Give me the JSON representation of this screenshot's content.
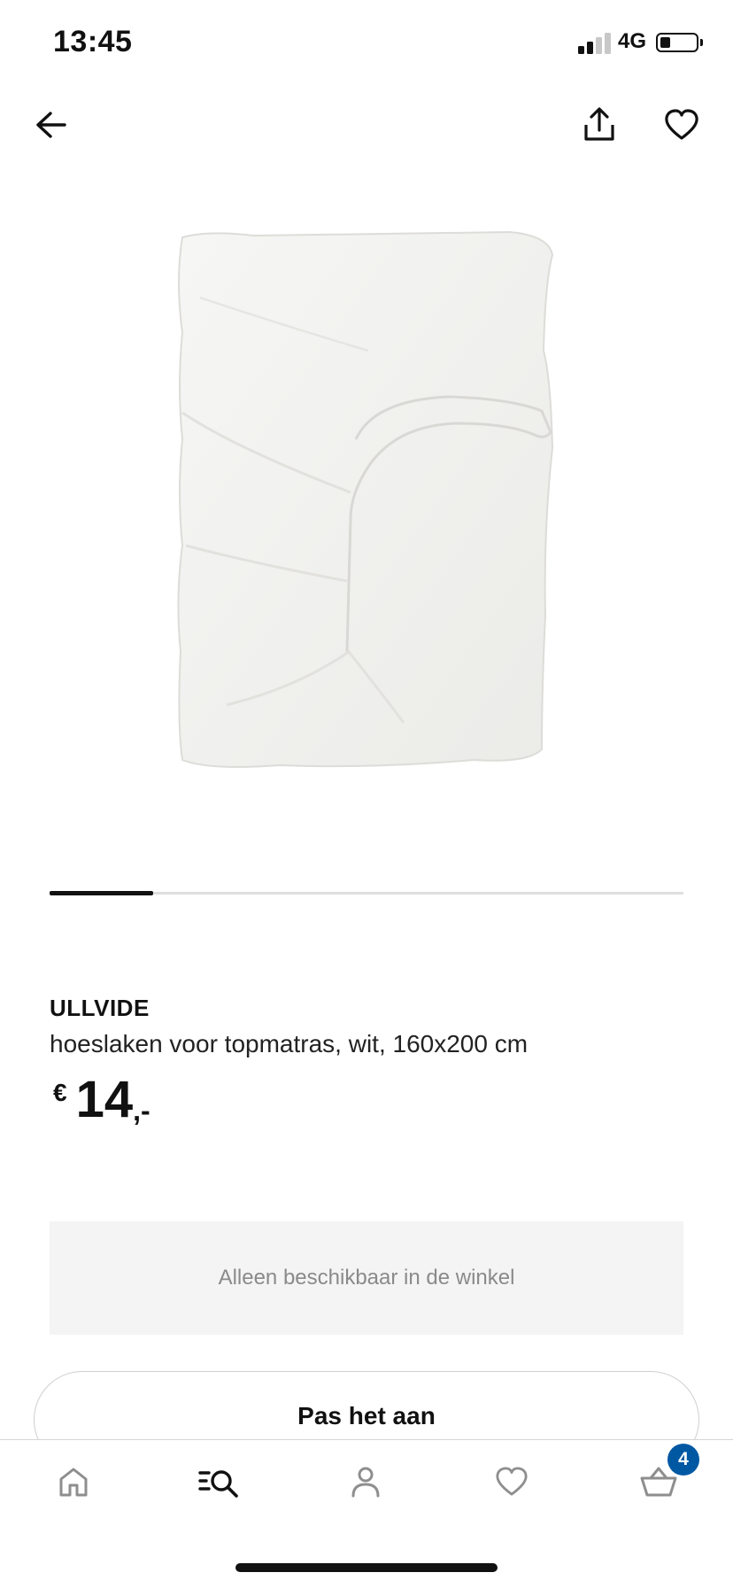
{
  "status_bar": {
    "time": "13:45",
    "network": "4G",
    "signal_bars_active": 2,
    "signal_bars_total": 4,
    "battery_level": 0.3
  },
  "top_nav": {
    "back_icon": "arrow-left-icon",
    "share_icon": "share-icon",
    "favorite_icon": "heart-icon"
  },
  "carousel": {
    "current_index": 1,
    "progress_fraction": 0.163
  },
  "product": {
    "name": "ULLVIDE",
    "description": "hoeslaken voor topmatras, wit, 160x200 cm",
    "currency": "€",
    "price_integer": "14",
    "price_decimal": ",-"
  },
  "availability": {
    "text": "Alleen beschikbaar in de winkel"
  },
  "customize": {
    "label": "Pas het aan"
  },
  "tab_bar": {
    "items": [
      {
        "name": "home",
        "icon": "home-icon",
        "active": false
      },
      {
        "name": "search",
        "icon": "search-icon",
        "active": true
      },
      {
        "name": "account",
        "icon": "person-icon",
        "active": false
      },
      {
        "name": "favorites",
        "icon": "heart-icon",
        "active": false
      },
      {
        "name": "cart",
        "icon": "basket-icon",
        "active": false
      }
    ],
    "cart_count": "4"
  },
  "colors": {
    "accent_blue": "#0058a3",
    "text_dark": "#111111",
    "muted_text": "#8a8a8a",
    "panel_bg": "#f4f4f4"
  }
}
